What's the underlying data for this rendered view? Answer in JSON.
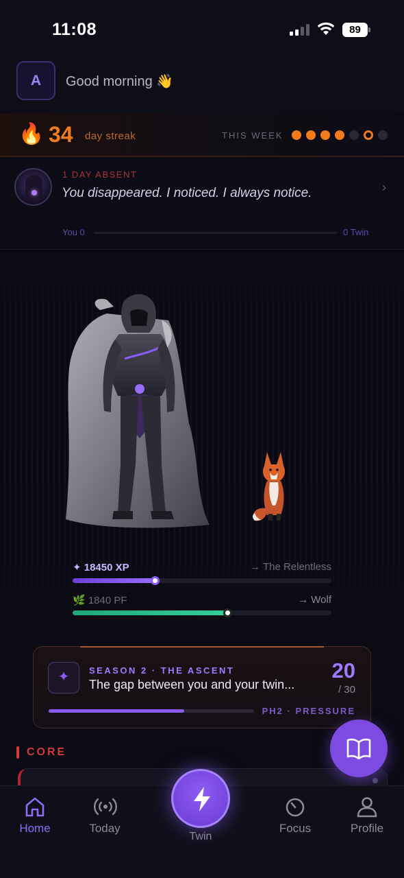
{
  "status_bar": {
    "time": "11:08",
    "battery": "89"
  },
  "header": {
    "avatar_initial": "A",
    "greeting": "Good morning 👋"
  },
  "streak": {
    "flame": "🔥",
    "count": "34",
    "label": "day streak",
    "week_label": "THIS WEEK",
    "week_days": [
      "filled",
      "filled",
      "filled",
      "filled",
      "empty",
      "today",
      "empty"
    ]
  },
  "absence": {
    "label": "1 DAY ABSENT",
    "message": "You disappeared. I noticed. I always notice.",
    "you_label": "You 0",
    "twin_label": "0 Twin"
  },
  "progress": {
    "xp_value": "✦ 18450 XP",
    "xp_next": "→ The Relentless",
    "xp_fraction": 0.32,
    "pf_value": "🌿 1840 PF",
    "pf_next": "→ Wolf",
    "pf_fraction": 0.6
  },
  "season": {
    "icon": "✦",
    "title": "SEASON 2 · THE ASCENT",
    "description": "The gap between you and your twin...",
    "day": "20",
    "total": "/ 30",
    "phase": "PH2 · PRESSURE",
    "fraction": 0.66
  },
  "core": {
    "label": "CORE"
  },
  "tabs": [
    {
      "label": "Home",
      "icon": "home-icon",
      "active": true
    },
    {
      "label": "Today",
      "icon": "broadcast-icon",
      "active": false
    },
    {
      "label": "Twin",
      "icon": "lightning-icon",
      "active": false
    },
    {
      "label": "Focus",
      "icon": "timer-icon",
      "active": false
    },
    {
      "label": "Profile",
      "icon": "profile-icon",
      "active": false
    }
  ],
  "colors": {
    "accent": "#8a5cf6",
    "streak": "#f07b1c",
    "absent": "#a8323a",
    "pf": "#33d19a"
  }
}
